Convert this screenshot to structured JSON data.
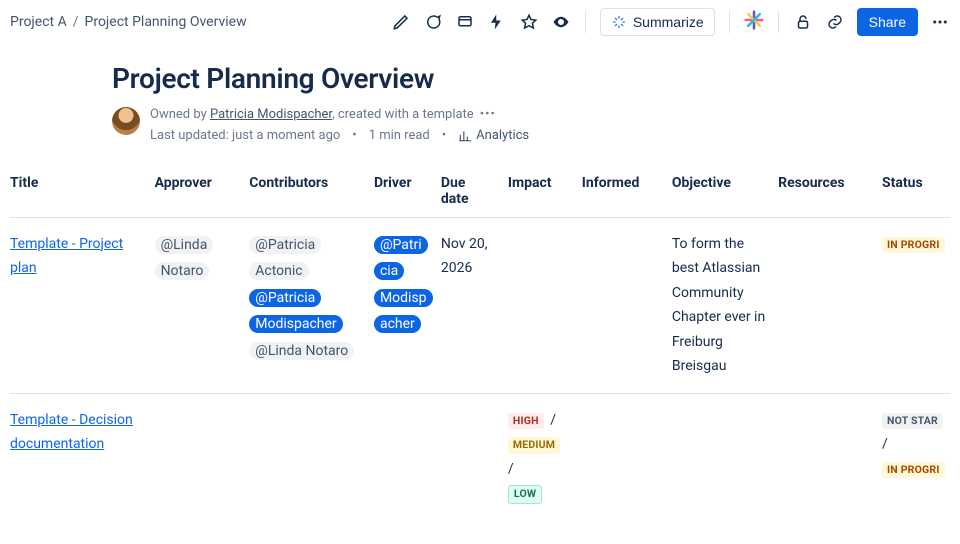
{
  "breadcrumb": {
    "parent": "Project A",
    "current": "Project Planning Overview"
  },
  "toolbar": {
    "summarize": "Summarize",
    "share": "Share"
  },
  "page": {
    "title": "Project Planning Overview",
    "owned_by_prefix": "Owned by ",
    "owner": "Patricia Modispacher",
    "created_suffix": ", created with a template",
    "updated": "Last updated: just a moment ago",
    "read_time": "1 min read",
    "analytics": "Analytics"
  },
  "columns": {
    "title": "Title",
    "approver": "Approver",
    "contributors": "Contributors",
    "driver": "Driver",
    "due_date": "Due date",
    "impact": "Impact",
    "informed": "Informed",
    "objective": "Objective",
    "resources": "Resources",
    "status": "Status"
  },
  "rows": [
    {
      "title": "Template - Project plan",
      "approver": "@Linda Notaro",
      "contributors": [
        "@Patricia Actonic",
        "@Patricia Modispacher",
        "@Linda Notaro"
      ],
      "contributors_selected_index": 1,
      "driver": "@Patricia Modispacher",
      "driver_selected": true,
      "due_date": "Nov 20, 2026",
      "objective": "To form the best Atlassian Community Chapter ever in Freiburg Breisgau",
      "status": [
        "IN PROGRI"
      ]
    },
    {
      "title": "Template - Decision documentation",
      "impact": [
        "HIGH",
        "MEDIUM",
        "LOW"
      ],
      "status": [
        "NOT STAR",
        "/",
        "IN PROGRI"
      ]
    }
  ]
}
